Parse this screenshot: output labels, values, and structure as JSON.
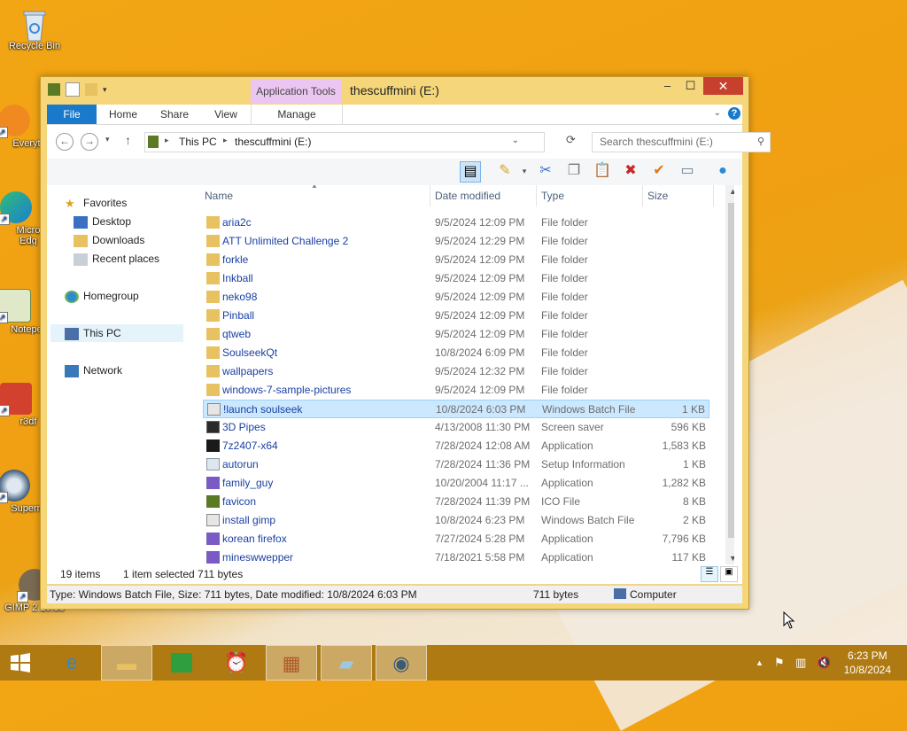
{
  "desktop": {
    "icons": [
      {
        "label": "Recycle Bin",
        "icon": "recycle-bin-icon"
      },
      {
        "label": "Everyt",
        "icon": "everything-icon"
      },
      {
        "label": "Micro",
        "label2": "Edg",
        "icon": "edge-icon"
      },
      {
        "label": "Notepe",
        "icon": "notepad-icon"
      },
      {
        "label": "r3df",
        "icon": "r3df-icon"
      },
      {
        "label": "Supern",
        "icon": "supermium-icon"
      },
      {
        "label": "GIMP 2.10.38",
        "icon": "gimp-icon"
      }
    ]
  },
  "window": {
    "title": "thescuffmini (E:)",
    "app_tools_label": "Application Tools",
    "close_glyph": "✕",
    "minimize_glyph": "–",
    "maximize_glyph": "☐"
  },
  "ribbon": {
    "tabs": [
      "File",
      "Home",
      "Share",
      "View",
      "Manage"
    ],
    "help_glyph": "?"
  },
  "address": {
    "crumbs": [
      "This PC",
      "thescuffmini (E:)"
    ],
    "search_placeholder": "Search thescuffmini (E:)"
  },
  "nav": {
    "favorites": "Favorites",
    "desktop": "Desktop",
    "downloads": "Downloads",
    "recent": "Recent places",
    "homegroup": "Homegroup",
    "thispc": "This PC",
    "network": "Network"
  },
  "columns": {
    "name": "Name",
    "date": "Date modified",
    "type": "Type",
    "size": "Size"
  },
  "files": [
    {
      "name": "aria2c",
      "date": "9/5/2024 12:09 PM",
      "type": "File folder",
      "size": "",
      "kind": "folder"
    },
    {
      "name": "ATT Unlimited Challenge 2",
      "date": "9/5/2024 12:29 PM",
      "type": "File folder",
      "size": "",
      "kind": "folder"
    },
    {
      "name": "forkle",
      "date": "9/5/2024 12:09 PM",
      "type": "File folder",
      "size": "",
      "kind": "folder"
    },
    {
      "name": "Inkball",
      "date": "9/5/2024 12:09 PM",
      "type": "File folder",
      "size": "",
      "kind": "folder"
    },
    {
      "name": "neko98",
      "date": "9/5/2024 12:09 PM",
      "type": "File folder",
      "size": "",
      "kind": "folder"
    },
    {
      "name": "Pinball",
      "date": "9/5/2024 12:09 PM",
      "type": "File folder",
      "size": "",
      "kind": "folder"
    },
    {
      "name": "qtweb",
      "date": "9/5/2024 12:09 PM",
      "type": "File folder",
      "size": "",
      "kind": "folder"
    },
    {
      "name": "SoulseekQt",
      "date": "10/8/2024 6:09 PM",
      "type": "File folder",
      "size": "",
      "kind": "folder"
    },
    {
      "name": "wallpapers",
      "date": "9/5/2024 12:32 PM",
      "type": "File folder",
      "size": "",
      "kind": "folder"
    },
    {
      "name": "windows-7-sample-pictures",
      "date": "9/5/2024 12:09 PM",
      "type": "File folder",
      "size": "",
      "kind": "folder"
    },
    {
      "name": "!launch soulseek",
      "date": "10/8/2024 6:03 PM",
      "type": "Windows Batch File",
      "size": "1 KB",
      "kind": "bat",
      "selected": true
    },
    {
      "name": "3D Pipes",
      "date": "4/13/2008 11:30 PM",
      "type": "Screen saver",
      "size": "596 KB",
      "kind": "scr"
    },
    {
      "name": "7z2407-x64",
      "date": "7/28/2024 12:08 AM",
      "type": "Application",
      "size": "1,583 KB",
      "kind": "app7z"
    },
    {
      "name": "autorun",
      "date": "7/28/2024 11:36 PM",
      "type": "Setup Information",
      "size": "1 KB",
      "kind": "inf"
    },
    {
      "name": "family_guy",
      "date": "10/20/2004 11:17 ...",
      "type": "Application",
      "size": "1,282 KB",
      "kind": "app"
    },
    {
      "name": "favicon",
      "date": "7/28/2024 11:39 PM",
      "type": "ICO File",
      "size": "8 KB",
      "kind": "ico"
    },
    {
      "name": "install gimp",
      "date": "10/8/2024 6:23 PM",
      "type": "Windows Batch File",
      "size": "2 KB",
      "kind": "bat"
    },
    {
      "name": "korean firefox",
      "date": "7/27/2024 5:28 PM",
      "type": "Application",
      "size": "7,796 KB",
      "kind": "app"
    },
    {
      "name": "mineswwepper",
      "date": "7/18/2021 5:58 PM",
      "type": "Application",
      "size": "117 KB",
      "kind": "app"
    }
  ],
  "status": {
    "items": "19 items",
    "selected": "1 item selected  711 bytes",
    "detail": "Type: Windows Batch File, Size: 711 bytes, Date modified: 10/8/2024 6:03 PM",
    "size": "711 bytes",
    "location": "Computer"
  },
  "taskbar": {
    "time": "6:23 PM",
    "date": "10/8/2024"
  }
}
